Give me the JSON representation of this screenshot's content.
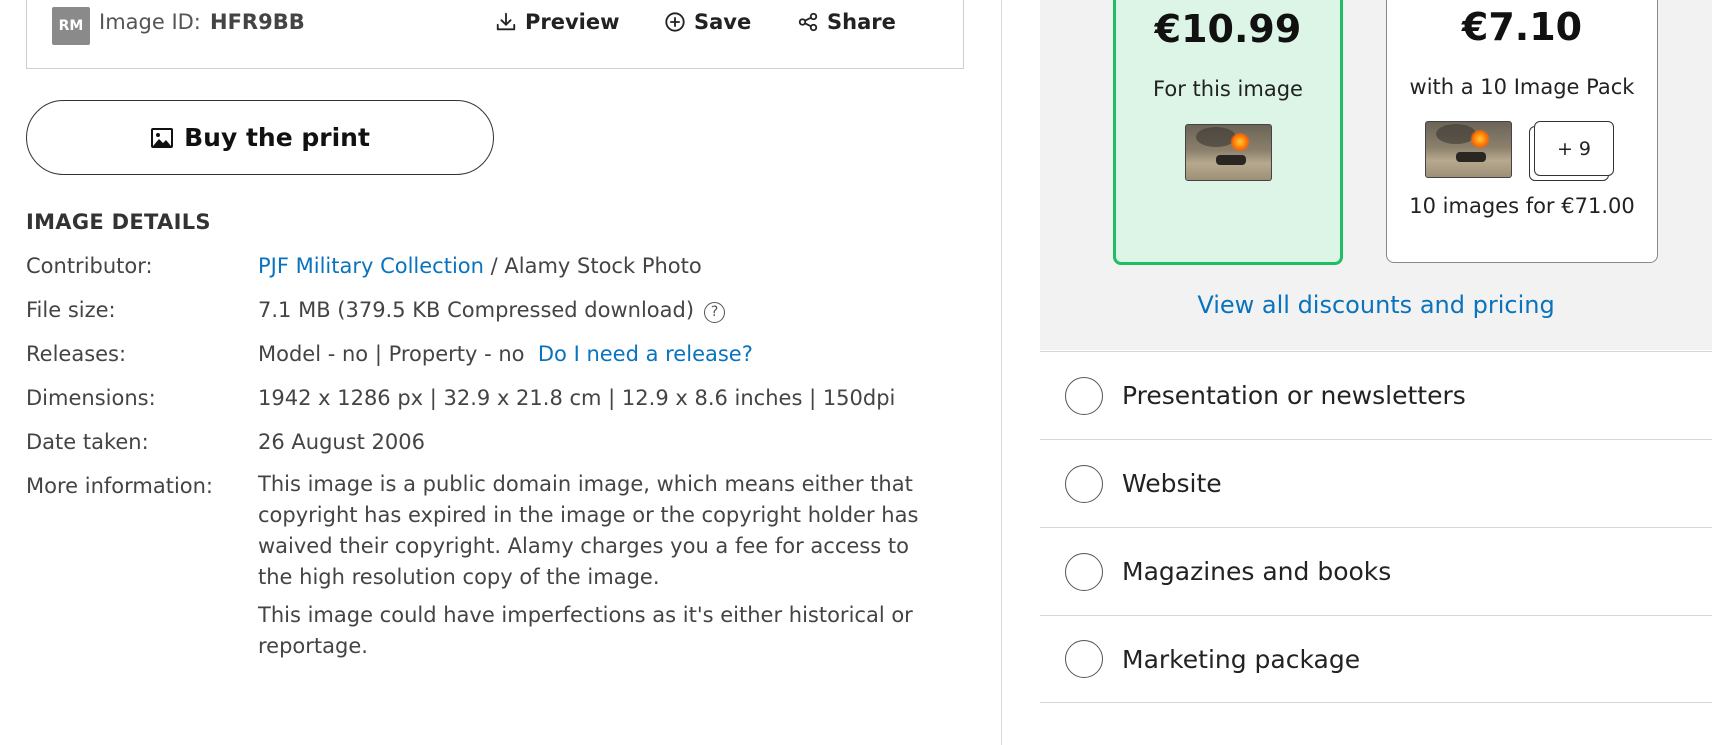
{
  "header": {
    "rights_badge": "RM",
    "image_id_label": "Image ID:",
    "image_id": "HFR9BB",
    "preview_label": "Preview",
    "save_label": "Save",
    "share_label": "Share"
  },
  "buy_print_label": "Buy the print",
  "details": {
    "title": "IMAGE DETAILS",
    "contributor_label": "Contributor:",
    "contributor_link": "PJF Military Collection",
    "contributor_rest": "/ Alamy Stock Photo",
    "filesize_label": "File size:",
    "filesize_value": "7.1 MB (379.5 KB Compressed download)",
    "help_glyph": "?",
    "releases_label": "Releases:",
    "releases_value": "Model - no | Property - no",
    "release_link": "Do I need a release?",
    "dimensions_label": "Dimensions:",
    "dimensions_value": "1942 x 1286 px | 32.9 x 21.8 cm | 12.9 x 8.6 inches | 150dpi",
    "date_label": "Date taken:",
    "date_value": "26 August 2006",
    "more_label": "More information:",
    "more_para1": "This image is a public domain image, which means either that copyright has expired in the image or the copyright holder has waived their copyright. Alamy charges you a fee for access to the high resolution copy of the image.",
    "more_para2": "This image could have imperfections as it's either historical or reportage."
  },
  "pricing": {
    "single_price": "€10.99",
    "single_sub": "For this image",
    "pack_price": "€7.10",
    "pack_sub": "with a 10 Image Pack",
    "pack_count": "+ 9",
    "pack_total": "10 images for €71.00",
    "view_all": "View all discounts and pricing"
  },
  "usage_options": [
    {
      "label": "Presentation or newsletters"
    },
    {
      "label": "Website"
    },
    {
      "label": "Magazines and books"
    },
    {
      "label": "Marketing package"
    }
  ],
  "colors": {
    "link": "#0a73bd",
    "selected_card_bg": "#dcf5e6",
    "selected_card_border": "#1ebe62",
    "badge_bg": "#8a8a8a"
  }
}
